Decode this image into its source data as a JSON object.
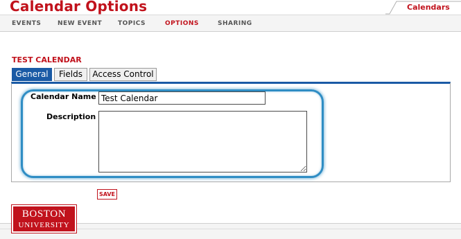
{
  "header": {
    "title": "Calendar Options",
    "calendars_tab": "Calendars"
  },
  "nav": {
    "items": [
      {
        "label": "EVENTS",
        "active": false
      },
      {
        "label": "NEW EVENT",
        "active": false
      },
      {
        "label": "TOPICS",
        "active": false
      },
      {
        "label": "OPTIONS",
        "active": true
      },
      {
        "label": "SHARING",
        "active": false
      }
    ]
  },
  "section": {
    "title": "TEST CALENDAR"
  },
  "tabs": [
    {
      "label": "General",
      "active": true
    },
    {
      "label": "Fields",
      "active": false
    },
    {
      "label": "Access Control",
      "active": false
    }
  ],
  "form": {
    "name_label": "Calendar Name",
    "name_value": "Test Calendar",
    "description_label": "Description",
    "description_value": "",
    "save_label": "SAVE"
  },
  "logo": {
    "line1": "BOSTON",
    "line2": "UNIVERSITY"
  },
  "colors": {
    "brand_red": "#c1121c",
    "tab_blue": "#1a5aa5",
    "highlight_blue": "#2f8dc4"
  },
  "icons": [
    "resize-grip-icon"
  ]
}
